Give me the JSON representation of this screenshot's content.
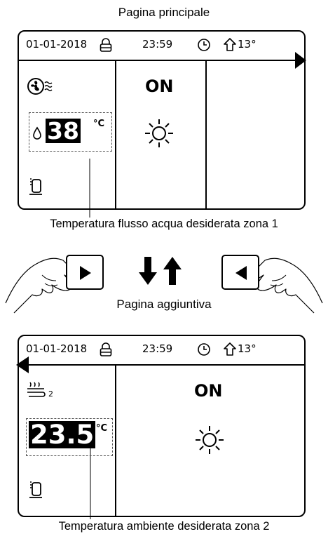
{
  "top": {
    "caption": "Pagina principale",
    "status": {
      "date": "01-01-2018",
      "time": "23:59",
      "outdoor_temp": "13°"
    },
    "mode_status": "ON",
    "setpoint": {
      "value": "38",
      "unit": "°C"
    },
    "annotation": "Temperatura flusso acqua desiderata zona 1"
  },
  "bottom": {
    "caption": "Pagina aggiuntiva",
    "status": {
      "date": "01-01-2018",
      "time": "23:59",
      "outdoor_temp": "13°"
    },
    "mode_status": "ON",
    "zone_index": "2",
    "setpoint": {
      "value": "23.5",
      "unit": "°C"
    },
    "annotation": "Temperatura ambiente desiderata zona 2"
  },
  "icons": {
    "lock": "lock-icon",
    "clock": "clock-icon",
    "outdoor": "house-outline-icon",
    "fan": "fan-icon",
    "drop": "water-drop-icon",
    "tank": "water-tank-icon",
    "sun": "sun-icon",
    "floor_heating": "floor-heating-icon",
    "right_button": "right-arrow-button",
    "left_button": "left-arrow-button",
    "swap": "down-up-arrows-icon"
  }
}
